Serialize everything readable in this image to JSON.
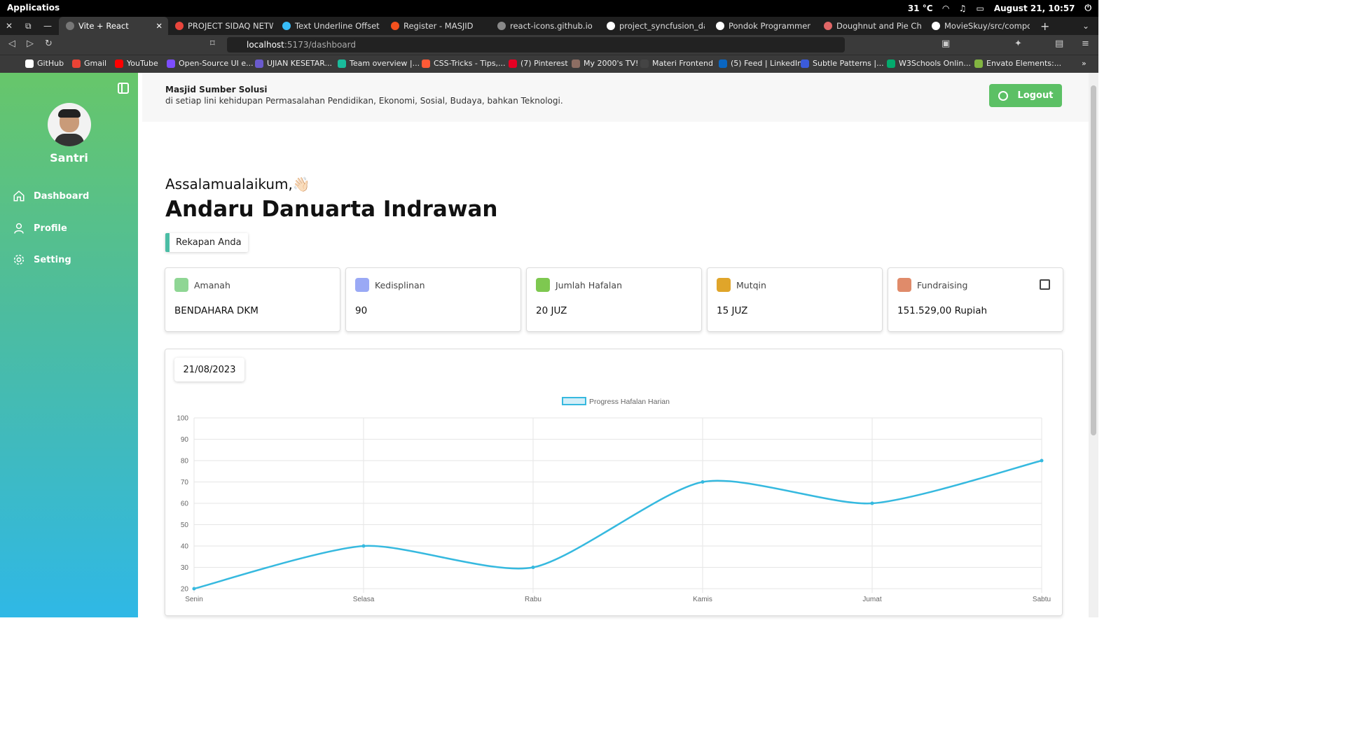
{
  "system": {
    "app_menu": "Applicatios",
    "temperature": "31 °C",
    "datetime": "August 21, 10:57"
  },
  "browser": {
    "tabs": [
      {
        "label": "Vite + React",
        "color": "#777777"
      },
      {
        "label": "PROJECT SIDAQ NETWOR",
        "color": "#e8453c"
      },
      {
        "label": "Text Underline Offset - Ta",
        "color": "#38bdf8"
      },
      {
        "label": "Register - MASJID",
        "color": "#f4511e"
      },
      {
        "label": "react-icons.github.io",
        "color": "#888888"
      },
      {
        "label": "project_syncfusion_dashb",
        "color": "#ffffff"
      },
      {
        "label": "Pondok Programmer",
        "color": "#ffffff"
      },
      {
        "label": "Doughnut and Pie Charts",
        "color": "#e06666"
      },
      {
        "label": "MovieSkuy/src/componen",
        "color": "#ffffff"
      }
    ],
    "url_host": "localhost",
    "url_path": ":5173/dashboard",
    "bookmarks": [
      {
        "label": "GitHub",
        "color": "#ffffff"
      },
      {
        "label": "Gmail",
        "color": "#ea4335"
      },
      {
        "label": "YouTube",
        "color": "#ff0000"
      },
      {
        "label": "Open-Source UI e...",
        "color": "#7c4dff"
      },
      {
        "label": "UJIAN KESETAR...",
        "color": "#6a5acd"
      },
      {
        "label": "Team overview |...",
        "color": "#1abc9c"
      },
      {
        "label": "CSS-Tricks - Tips,...",
        "color": "#ff5a36"
      },
      {
        "label": "(7) Pinterest",
        "color": "#e60023"
      },
      {
        "label": "My 2000's TV!",
        "color": "#8d6e63"
      },
      {
        "label": "Materi Frontend",
        "color": "#444444"
      },
      {
        "label": "(5) Feed | LinkedIn",
        "color": "#0a66c2"
      },
      {
        "label": "Subtle Patterns |...",
        "color": "#3b5bdb"
      },
      {
        "label": "W3Schools Onlin...",
        "color": "#04aa6d"
      },
      {
        "label": "Envato Elements:...",
        "color": "#82b541"
      }
    ]
  },
  "sidebar": {
    "name": "Santri",
    "items": [
      {
        "label": "Dashboard",
        "icon": "home-icon"
      },
      {
        "label": "Profile",
        "icon": "user-icon"
      },
      {
        "label": "Setting",
        "icon": "gear-icon"
      }
    ]
  },
  "header": {
    "title": "Masjid Sumber Solusi",
    "subtitle": "di setiap lini kehidupan Permasalahan Pendidikan, Ekonomi, Sosial, Budaya, bahkan Teknologi.",
    "logout": "Logout"
  },
  "main": {
    "greeting": "Assalamualaikum,👋🏻",
    "user": "Andaru Danuarta Indrawan",
    "recap_label": "Rekapan Anda",
    "cards": [
      {
        "label": "Amanah",
        "value": "BENDAHARA DKM",
        "icon": "handshake-icon",
        "color": "#8fd694"
      },
      {
        "label": "Kedisplinan",
        "value": "90",
        "icon": "user-check-icon",
        "color": "#9aa9f5"
      },
      {
        "label": "Jumlah Hafalan",
        "value": "20 JUZ",
        "icon": "quran-icon",
        "color": "#7ec850"
      },
      {
        "label": "Mutqin",
        "value": "15 JUZ",
        "icon": "open-book-icon",
        "color": "#e0a52a"
      },
      {
        "label": "Fundraising",
        "value": "151.529,00 Rupiah",
        "icon": "donation-icon",
        "color": "#e08b6a"
      }
    ],
    "date": "21/08/2023"
  },
  "chart_data": {
    "type": "line",
    "categories": [
      "Senin",
      "Selasa",
      "Rabu",
      "Kamis",
      "Jumat",
      "Sabtu"
    ],
    "series": [
      {
        "name": "Progress Hafalan Harian",
        "values": [
          20,
          40,
          30,
          70,
          60,
          80
        ],
        "color": "#36b9df"
      }
    ],
    "ylim": [
      20,
      100
    ],
    "yticks": [
      20,
      30,
      40,
      50,
      60,
      70,
      80,
      90,
      100
    ],
    "legend": "top",
    "grid": true
  }
}
